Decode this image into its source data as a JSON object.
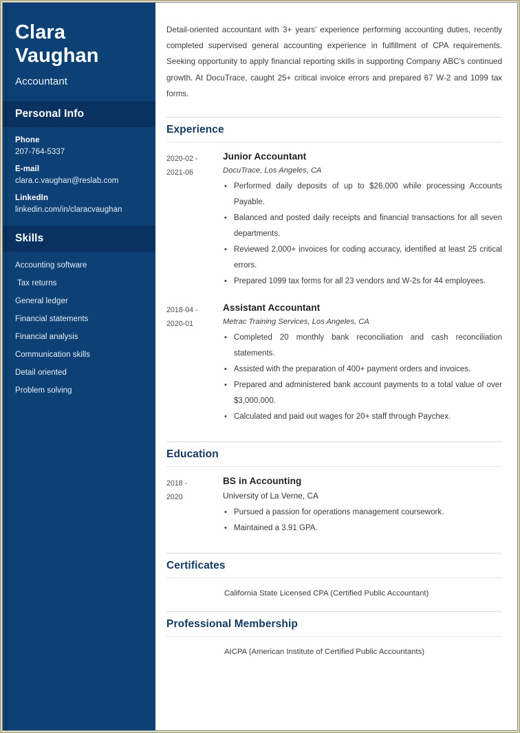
{
  "sidebar": {
    "name_line1": "Clara",
    "name_line2": "Vaughan",
    "job_title": "Accountant",
    "personal_info_heading": "Personal Info",
    "contacts": [
      {
        "label": "Phone",
        "value": "207-764-5337"
      },
      {
        "label": "E-mail",
        "value": "clara.c.vaughan@reslab.com"
      },
      {
        "label": "LinkedIn",
        "value": "linkedin.com/in/claracvaughan"
      }
    ],
    "skills_heading": "Skills",
    "skills": [
      "Accounting software",
      " Tax returns",
      "General ledger",
      "Financial statements",
      "Financial analysis",
      "Communication skills",
      "Detail oriented",
      "Problem solving"
    ]
  },
  "main": {
    "summary": "Detail-oriented accountant with 3+ years’ experience performing accounting duties, recently completed supervised general accounting experience in fulfillment of CPA requirements. Seeking opportunity to apply financial reporting skills in supporting Company ABC’s continued growth. At DocuTrace, caught 25+ critical invoice errors and prepared 67 W-2 and 1099 tax forms.",
    "experience": {
      "heading": "Experience",
      "entries": [
        {
          "date_start": "2020-02 -",
          "date_end": "2021-06",
          "role": "Junior Accountant",
          "org": "DocuTrace, Los Angeles, CA",
          "bullets": [
            "Performed daily deposits of up to $26,000 while processing Accounts Payable.",
            "Balanced and posted daily receipts and financial transactions for all seven departments.",
            "Reviewed 2,000+ invoices for coding accuracy, identified at least 25 critical errors.",
            "Prepared 1099 tax forms for all 23 vendors and W-2s for 44 employees."
          ]
        },
        {
          "date_start": "2018-04 -",
          "date_end": "2020-01",
          "role": "Assistant Accountant",
          "org": "Metrac Training Services, Los Angeles, CA",
          "bullets": [
            "Completed 20 monthly bank reconciliation and cash reconciliation statements.",
            "Assisted with the preparation of 400+ payment orders and invoices.",
            "Prepared and administered bank account payments to a total value of over $3,000,000.",
            "Calculated and paid out wages for 20+ staff through Paychex."
          ]
        }
      ]
    },
    "education": {
      "heading": "Education",
      "entries": [
        {
          "date_start": "2018 -",
          "date_end": "2020",
          "role": "BS in Accounting",
          "org": "University of La Verne, CA",
          "bullets": [
            "Pursued a passion for operations management coursework.",
            "Maintained a 3.91 GPA."
          ]
        }
      ]
    },
    "certificates": {
      "heading": "Certificates",
      "items": [
        "California State Licensed CPA (Certified Public Accountant)"
      ]
    },
    "membership": {
      "heading": "Professional Membership",
      "items": [
        "AICPA (American Institute of Certified Public Accountants)"
      ]
    }
  },
  "colors": {
    "sidebar_bg": "#0d4074",
    "sidebar_heading_bg": "#0a3261",
    "section_title": "#12385f",
    "page_border": "#b5b08a"
  }
}
